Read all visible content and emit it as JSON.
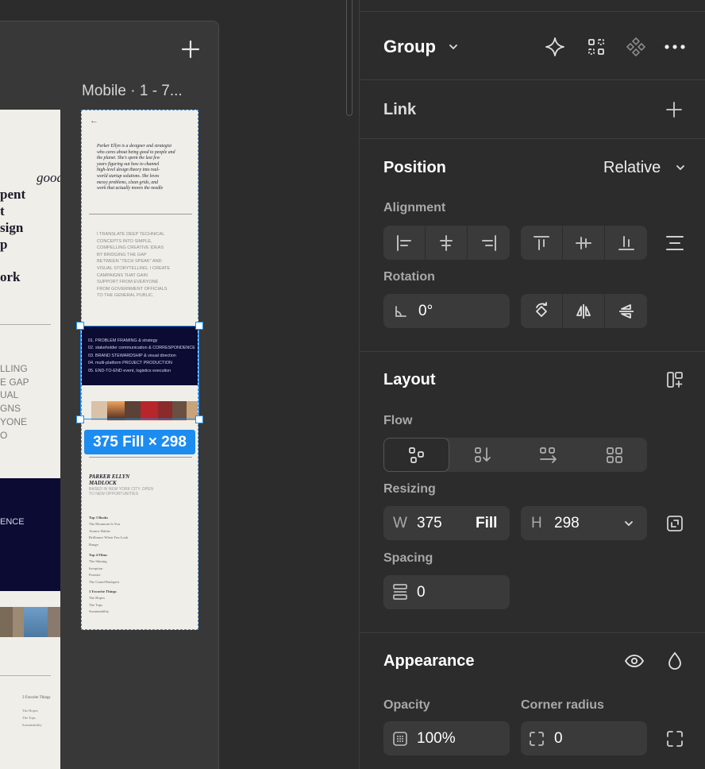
{
  "canvas": {
    "frame_label": "Mobile · 1 - 7...",
    "left_page": {
      "heading_lines": [
        "good",
        "pent",
        "t",
        "sign",
        "p",
        "ork"
      ],
      "sans_lines": [
        "LLING",
        "E GAP",
        "UAL",
        "GNS",
        "YONE",
        "O"
      ],
      "dark_text": "ENCE",
      "footer_heading": "3 Favorite Things",
      "footer_items": [
        "The Hopes",
        "The Tops",
        "Sustainability"
      ]
    },
    "mobile": {
      "back_arrow": "←",
      "bio_lines": [
        "Parker Ellyn is a designer and strategist",
        "who cares about being good to people and",
        "the planet. She's spent the last few",
        "years figuring out how to channel",
        "high-level design theory into real-",
        "world startup solutions. She loves",
        "messy problems, clean grids, and",
        "work that actually moves the needle"
      ],
      "translate_lines": [
        "I TRANSLATE DEEP TECHNICAL",
        "CONCEPTS INTO SIMPLE,",
        "COMPELLING CREATIVE IDEAS",
        "BY BRIDGING THE GAP",
        "BETWEEN \"TECH SPEAK\" AND",
        "VISUAL STORYTELLING. I CREATE",
        "CAMPAIGNS THAT GAIN",
        "SUPPORT FROM EVERYONE",
        "FROM GOVERNMENT OFFICIALS",
        "TO THE GENERAL PUBLIC."
      ],
      "services": [
        "01. PROBLEM FRAMING & strategy",
        "02. stakeholder communication & CORRESPONDENCE",
        "03. BRAND STEWARDSHIP & visual direction",
        "04. multi-platform PROJECT PRODUCTION",
        "05. END-TO-END event, logistics execution"
      ],
      "name_lines": [
        "PARKER ELLYN",
        "MADLOCK"
      ],
      "name_sub_lines": [
        "BASED IN NEW YORK CITY. OPEN",
        "TO NEW OPPORTUNITIES"
      ],
      "lists": [
        {
          "heading": "Top 3 Books",
          "items": [
            "The Mountain Is You",
            "Atomic Habits",
            "Brilliance When You Look",
            "Range"
          ]
        },
        {
          "heading": "Top 4 Films",
          "items": [
            "The Shining",
            "Inception",
            "Parasite",
            "The Grand Budapest"
          ]
        },
        {
          "heading": "3 Favorite Things",
          "items": [
            "The Hopes",
            "The Tops",
            "Sustainability"
          ]
        }
      ]
    },
    "selection_badge": "375 Fill × 298"
  },
  "panel": {
    "group": {
      "title": "Group"
    },
    "link": {
      "title": "Link"
    },
    "position": {
      "title": "Position",
      "value": "Relative"
    },
    "alignment": {
      "label": "Alignment"
    },
    "rotation": {
      "label": "Rotation",
      "value": "0°"
    },
    "layout": {
      "title": "Layout"
    },
    "flow": {
      "label": "Flow"
    },
    "resizing": {
      "label": "Resizing",
      "w_label": "W",
      "w_value": "375",
      "w_mode": "Fill",
      "h_label": "H",
      "h_value": "298"
    },
    "spacing": {
      "label": "Spacing",
      "value": "0"
    },
    "appearance": {
      "title": "Appearance"
    },
    "opacity": {
      "label": "Opacity",
      "value": "100%"
    },
    "corner_radius": {
      "label": "Corner radius",
      "value": "0"
    }
  },
  "colors": {
    "panel_bg": "#2c2c2c",
    "field_bg": "#3a3a3a",
    "accent": "#1c8cf0",
    "dark_navy": "#0b0b33"
  }
}
